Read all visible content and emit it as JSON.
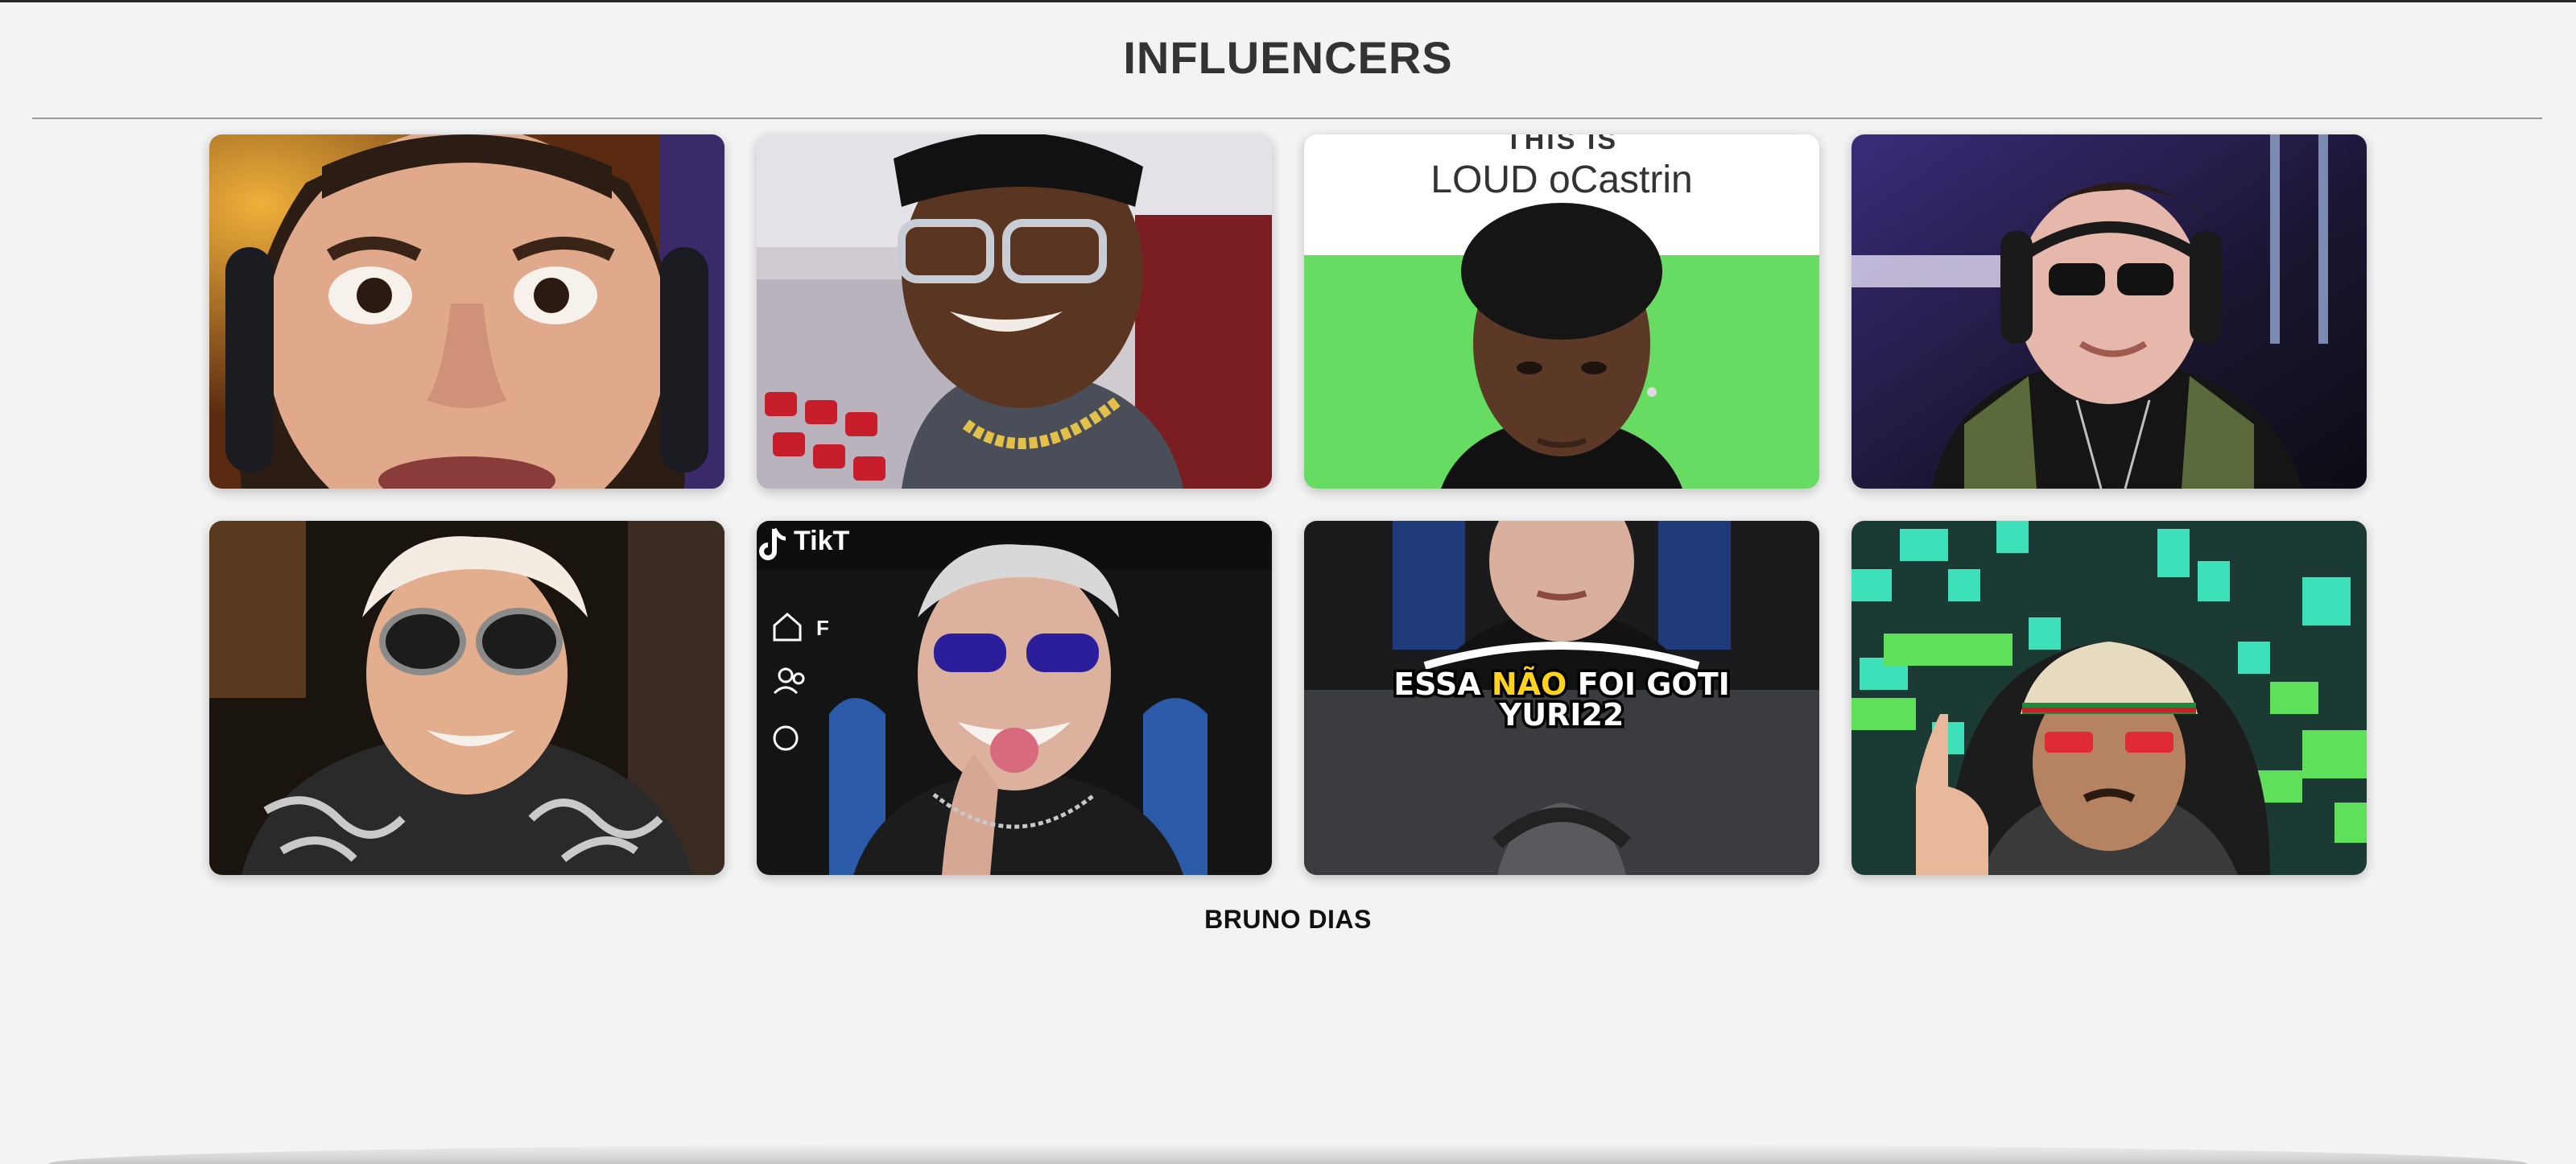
{
  "page": {
    "title": "INFLUENCERS",
    "footer_name": "BRUNO DIAS"
  },
  "colors": {
    "background": "#f3f3f3",
    "title": "#333333",
    "divider": "#9a9a9a",
    "green_screen": "#67dc62"
  },
  "cards": [
    {
      "id": "card-1",
      "description_icon": "wide-eyed-streamer-headphones-thumbnail"
    },
    {
      "id": "card-2",
      "description_icon": "stadium-glasses-chain-thumbnail"
    },
    {
      "id": "card-3",
      "description_icon": "green-screen-portrait-thumbnail",
      "caption_top": "THIS IS",
      "caption_main": "LOUD oCastrin"
    },
    {
      "id": "card-4",
      "description_icon": "sunglasses-gamer-headset-thumbnail"
    },
    {
      "id": "card-5",
      "description_icon": "blond-round-sunglasses-thumbnail"
    },
    {
      "id": "card-6",
      "description_icon": "tiktok-blue-sunglasses-thumbnail",
      "brand_text": "TikT",
      "side_letter": "F"
    },
    {
      "id": "card-7",
      "description_icon": "gaming-chair-caption-thumbnail",
      "caption_line1_a": "ESSA ",
      "caption_line1_b": "NÃO",
      "caption_line1_c": " FOI GOTI",
      "caption_line2": "YURI22"
    },
    {
      "id": "card-8",
      "description_icon": "minecraft-background-cap-thumbnail"
    }
  ]
}
